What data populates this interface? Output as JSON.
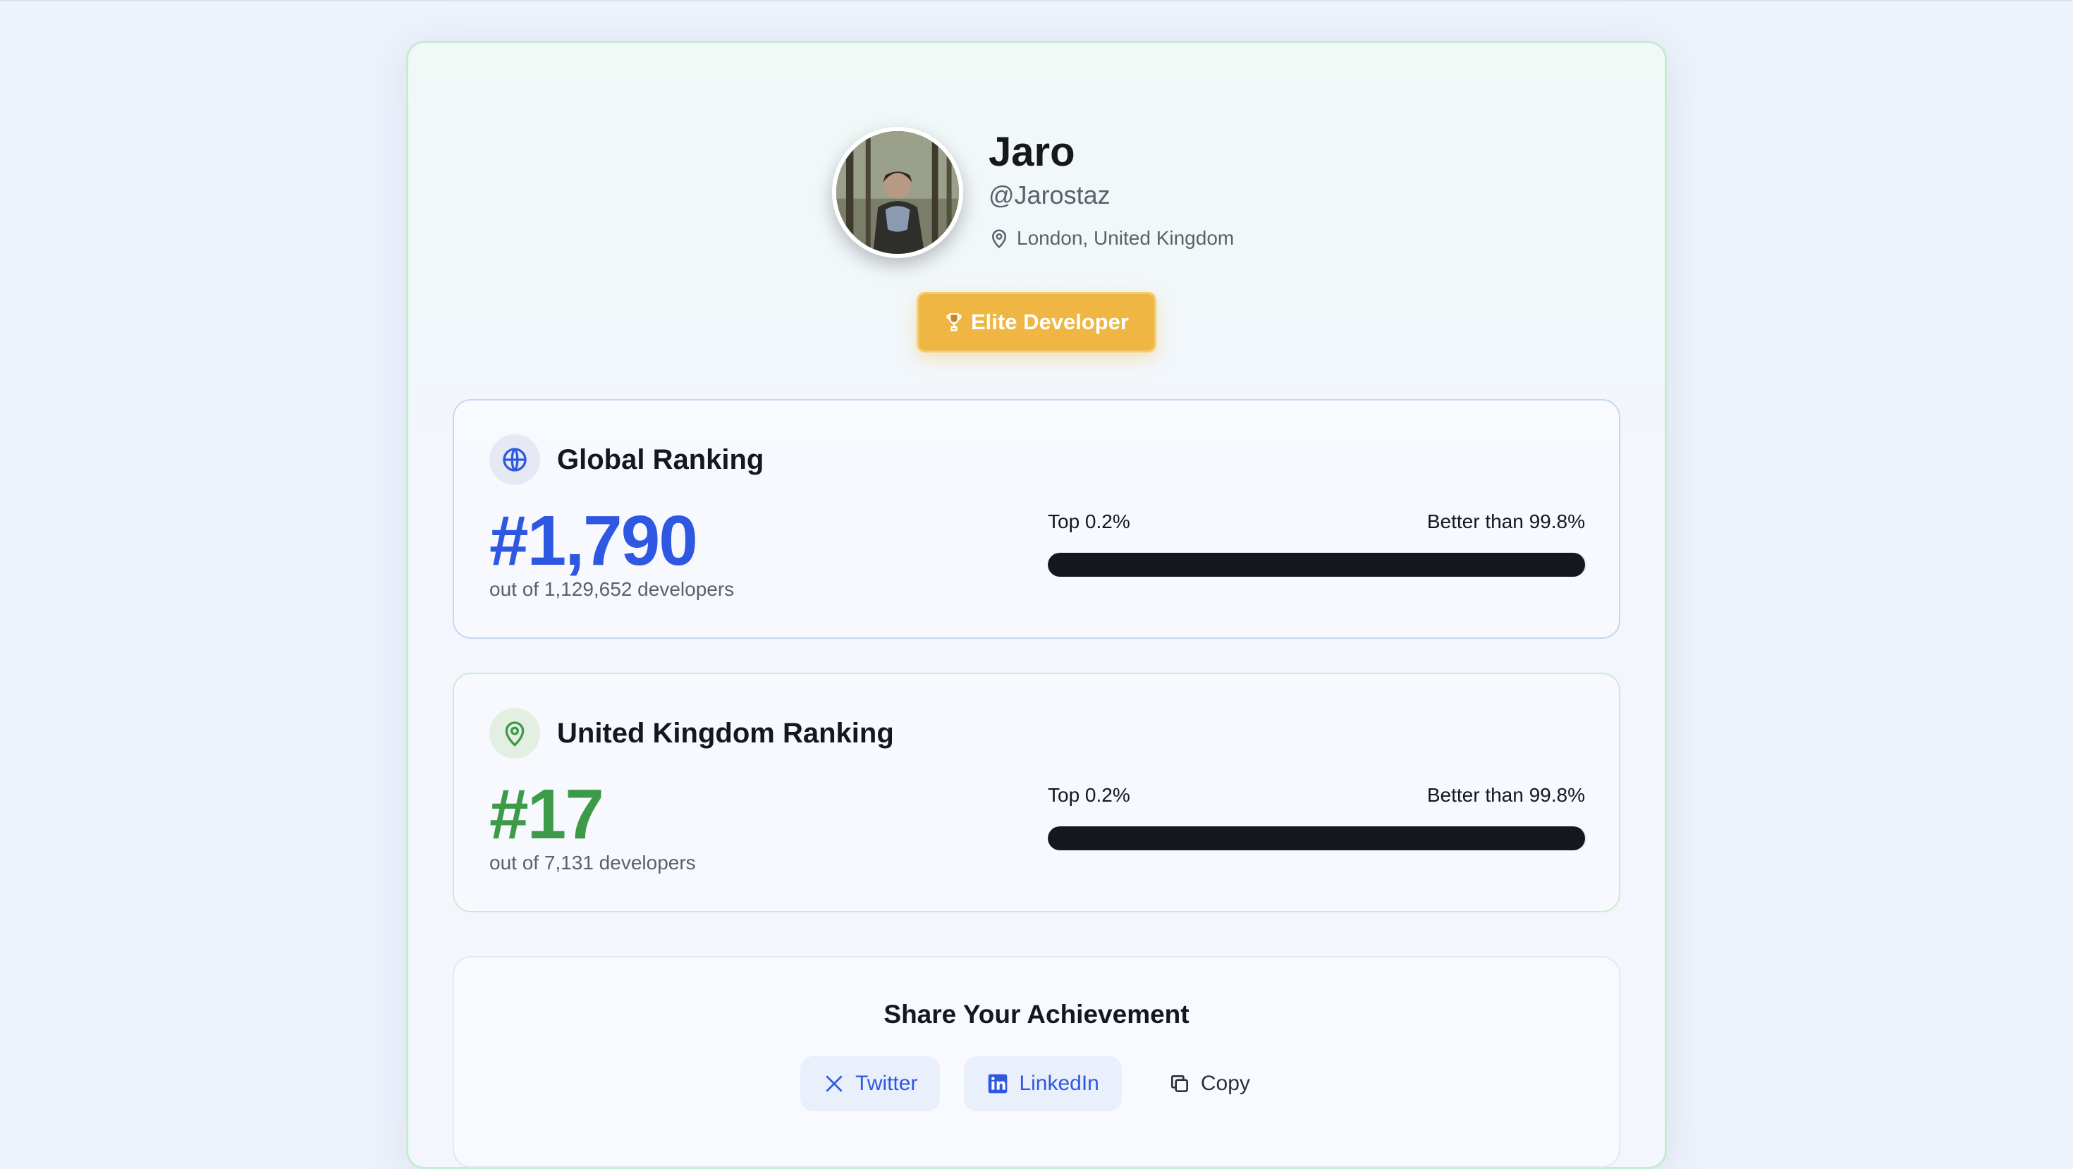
{
  "profile": {
    "name": "Jaro",
    "handle": "@Jarostaz",
    "location": "London, United Kingdom",
    "badge": "Elite Developer"
  },
  "rankings": [
    {
      "title": "Global Ranking",
      "rank": "#1,790",
      "total": "out of 1,129,652 developers",
      "top": "Top 0.2%",
      "better": "Better than 99.8%",
      "percentile": 0.998,
      "icon": "globe-icon",
      "color": "#2f58e2"
    },
    {
      "title": "United Kingdom Ranking",
      "rank": "#17",
      "total": "out of 7,131 developers",
      "top": "Top 0.2%",
      "better": "Better than 99.8%",
      "percentile": 0.998,
      "icon": "map-pin-icon",
      "color": "#3c9a48"
    }
  ],
  "share": {
    "title": "Share Your Achievement",
    "twitter": "Twitter",
    "linkedin": "LinkedIn",
    "copy": "Copy"
  },
  "colors": {
    "badge": "#efb643",
    "progress": "#14171c"
  }
}
